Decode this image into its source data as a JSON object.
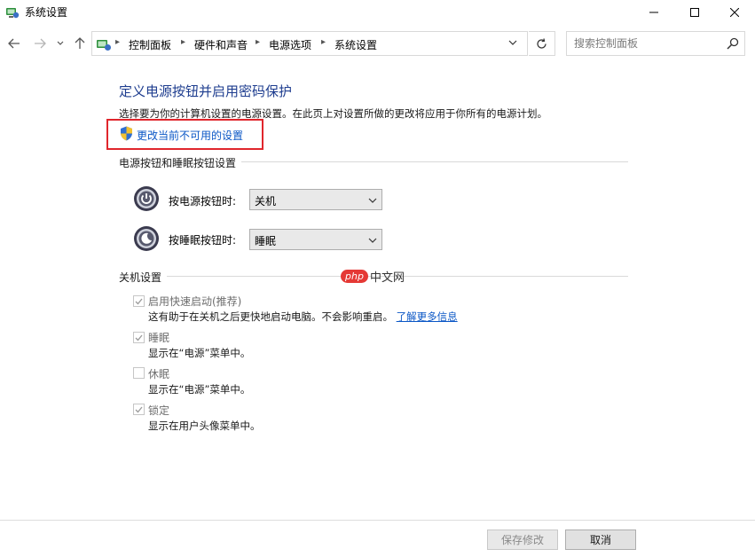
{
  "window": {
    "title": "系统设置",
    "app_icon": "control-panel-icon",
    "controls": {
      "minimize": "minimize-icon",
      "maximize": "maximize-icon",
      "close": "close-icon"
    }
  },
  "nav": {
    "back": "back-arrow-icon",
    "forward": "forward-arrow-icon",
    "recent": "recent-pages-icon",
    "up": "up-arrow-icon"
  },
  "address": {
    "breadcrumbs": [
      "控制面板",
      "硬件和声音",
      "电源选项",
      "系统设置"
    ],
    "location_icon": "control-panel-icon",
    "dropdown_icon": "chevron-down-icon",
    "refresh_icon": "refresh-icon"
  },
  "search": {
    "placeholder": "搜索控制面板",
    "icon": "search-icon"
  },
  "main": {
    "title": "定义电源按钮并启用密码保护",
    "description": "选择要为你的计算机设置的电源设置。在此页上对设置所做的更改将应用于你所有的电源计划。",
    "change_link": "更改当前不可用的设置",
    "power_section": {
      "heading": "电源按钮和睡眠按钮设置",
      "rows": [
        {
          "label": "按电源按钮时:",
          "value": "关机",
          "icon": "power-button-icon"
        },
        {
          "label": "按睡眠按钮时:",
          "value": "睡眠",
          "icon": "sleep-button-icon"
        }
      ]
    },
    "shutdown_section": {
      "heading": "关机设置",
      "options": [
        {
          "label": "启用快速启动(推荐)",
          "checked": true,
          "desc": "这有助于在关机之后更快地启动电脑。不会影响重启。",
          "link": "了解更多信息"
        },
        {
          "label": "睡眠",
          "checked": true,
          "desc": "显示在“电源”菜单中。"
        },
        {
          "label": "休眠",
          "checked": false,
          "desc": "显示在“电源”菜单中。"
        },
        {
          "label": "锁定",
          "checked": true,
          "desc": "显示在用户头像菜单中。"
        }
      ]
    }
  },
  "watermark": {
    "badge": "php",
    "text": "中文网"
  },
  "footer": {
    "save": "保存修改",
    "cancel": "取消"
  },
  "colors": {
    "title_blue": "#1e3d8f",
    "link_blue": "#0b57c6",
    "highlight_red": "#e0262c"
  }
}
